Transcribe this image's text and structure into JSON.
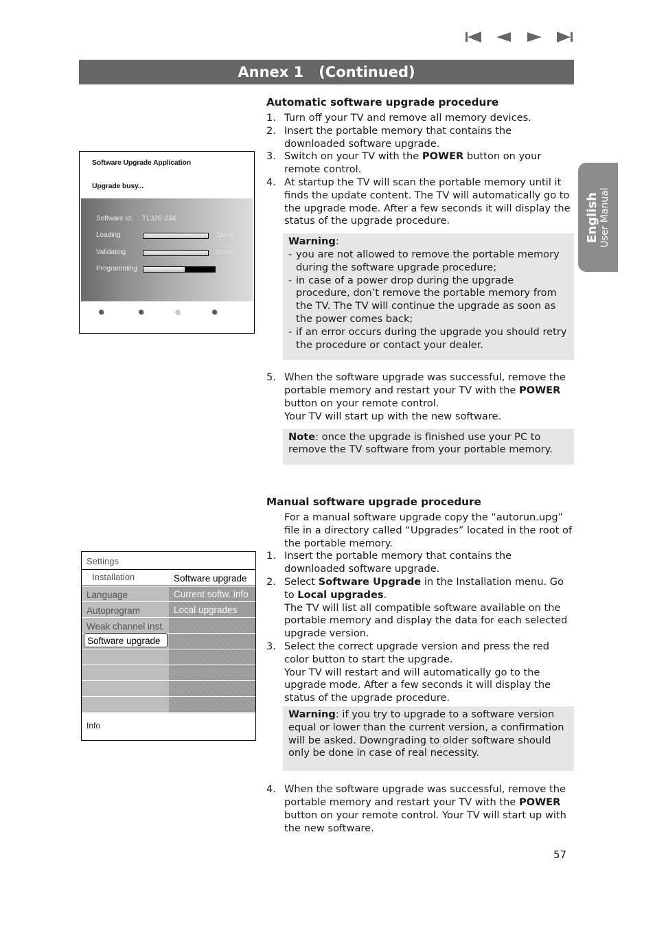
{
  "nav": {
    "buttons": [
      {
        "name": "first-page",
        "icon": "skip-to-start-icon"
      },
      {
        "name": "previous-page",
        "icon": "triangle-left-icon"
      },
      {
        "name": "next-page",
        "icon": "triangle-right-icon"
      },
      {
        "name": "last-page",
        "icon": "skip-to-end-icon"
      }
    ]
  },
  "header": {
    "title": "Annex 1   (Continued)"
  },
  "side_tab": {
    "language": "English",
    "subtitle": "User Manual"
  },
  "screen_upgrade": {
    "title": "Software Upgrade Application",
    "status": "Upgrade busy...",
    "software_id_label": "Software Id:",
    "software_id_value": "TL32E-234",
    "steps": [
      {
        "label": "Loading",
        "progress": 1.0,
        "state": "Done"
      },
      {
        "label": "Validating",
        "progress": 1.0,
        "state": "Done"
      },
      {
        "label": "Programming",
        "progress": 0.58,
        "state": ""
      }
    ],
    "color_dots": [
      "#555555",
      "#555555",
      "#cccccc",
      "#555555"
    ]
  },
  "screen_menu": {
    "header": "Settings",
    "submenu": "Installation",
    "right_title": "Software upgrade",
    "left_items": [
      "Language",
      "Autoprogram",
      "Weak channel inst.",
      "Software upgrade"
    ],
    "selected_item": "Software upgrade",
    "right_items": [
      "Current softw. info",
      "Local upgrades"
    ],
    "footer": "Info"
  },
  "auto": {
    "heading": "Automatic software upgrade procedure",
    "steps": [
      {
        "num": "1.",
        "text": "Turn off your TV and remove all memory devices."
      },
      {
        "num": "2.",
        "text": "Insert the portable memory that contains the downloaded software upgrade."
      },
      {
        "num": "3.",
        "pre": "Switch on your TV with the ",
        "bold": "POWER",
        "post": " button on your remote control."
      },
      {
        "num": "4.",
        "text": "At startup the TV will scan the portable memory until it finds the update content. The TV will automatically go to the upgrade mode. After a few seconds it will display the status of the upgrade procedure."
      }
    ],
    "warning": {
      "label": "Warning",
      "items": [
        "you are not allowed to remove the portable memory during the software upgrade procedure;",
        "in case of a power drop during the upgrade procedure, don’t remove the portable memory from the TV. The TV will continue the upgrade as soon as the power comes back;",
        "if an error occurs during the upgrade you should retry the procedure or contact your dealer."
      ]
    },
    "step5": {
      "num": "5.",
      "pre": "When the software upgrade was successful, remove the portable memory and restart your TV with the ",
      "bold": "POWER",
      "post": " button on your remote control.",
      "line2": "Your TV will start up with the new software."
    },
    "note": {
      "label": "Note",
      "text": ": once the upgrade is finished use your PC to remove the TV software from your portable memory."
    }
  },
  "manual": {
    "heading": "Manual software upgrade procedure",
    "intro": "For a manual software upgrade copy the “autorun.upg” file in a directory called “Upgrades” located in the root of the portable memory.",
    "step1": {
      "num": "1.",
      "text": "Insert the portable memory that contains the downloaded software upgrade."
    },
    "step2": {
      "num": "2.",
      "pre": "Select ",
      "bold1": "Software Upgrade",
      "mid": " in the Installation menu. Go to ",
      "bold2": "Local upgrades",
      "post": ".",
      "extra": "The TV will list all compatible software available on the portable memory and display the data for each selected upgrade version."
    },
    "step3": {
      "num": "3.",
      "text": "Select the correct upgrade version and press the red color button to start the upgrade.",
      "extra": "Your TV will restart and will automatically go to the upgrade mode. After a few seconds it will display the status of the upgrade procedure."
    },
    "warning": {
      "label": "Warning",
      "text": ": if you try to upgrade to a software version equal or lower than the current version, a confirmation will be asked. Downgrading to older software should only be done in case of real necessity."
    },
    "step4": {
      "num": "4.",
      "pre": "When the software upgrade was successful, remove the portable memory and restart your TV with the ",
      "bold": "POWER",
      "post": " button on your remote control. Your TV will start up with the new software."
    }
  },
  "page_number": "57"
}
